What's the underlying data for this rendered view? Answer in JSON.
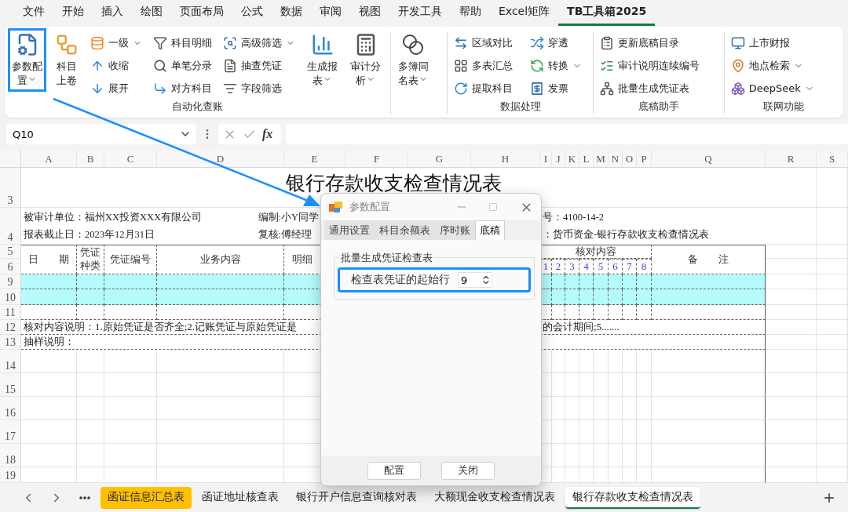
{
  "menu_tabs": [
    {
      "label": "文件",
      "selected": false
    },
    {
      "label": "开始",
      "selected": false
    },
    {
      "label": "插入",
      "selected": false
    },
    {
      "label": "绘图",
      "selected": false
    },
    {
      "label": "页面布局",
      "selected": false
    },
    {
      "label": "公式",
      "selected": false
    },
    {
      "label": "数据",
      "selected": false
    },
    {
      "label": "审阅",
      "selected": false
    },
    {
      "label": "视图",
      "selected": false
    },
    {
      "label": "开发工具",
      "selected": false
    },
    {
      "label": "帮助",
      "selected": false
    },
    {
      "label": "Excel矩阵",
      "selected": false
    },
    {
      "label": "TB工具箱2025",
      "selected": true
    }
  ],
  "ribbon": {
    "groups": [
      {
        "label": "自动化查账",
        "columns": [
          {
            "kind": "large",
            "label": "参数配置",
            "dropdown": true,
            "highlighted": true
          },
          {
            "kind": "large",
            "label": "科目上卷",
            "dropdown": false,
            "highlighted": false
          },
          {
            "kind": "stack",
            "items": [
              {
                "label": "一级",
                "dropdown": true
              },
              {
                "label": "收缩",
                "dropdown": false
              },
              {
                "label": "展开",
                "dropdown": false
              }
            ]
          },
          {
            "kind": "stack",
            "items": [
              {
                "label": "科目明细",
                "dropdown": false
              },
              {
                "label": "单笔分录",
                "dropdown": false
              },
              {
                "label": "对方科目",
                "dropdown": false
              }
            ]
          },
          {
            "kind": "stack",
            "items": [
              {
                "label": "高级筛选",
                "dropdown": true
              },
              {
                "label": "抽查凭证",
                "dropdown": false
              },
              {
                "label": "字段筛选",
                "dropdown": false
              }
            ]
          },
          {
            "kind": "large",
            "label": "生成报表",
            "dropdown": true,
            "highlighted": false
          },
          {
            "kind": "large",
            "label": "审计分析",
            "dropdown": true,
            "highlighted": false
          }
        ]
      },
      {
        "columns": [
          {
            "kind": "large",
            "label": "多簿同名表",
            "dropdown": true,
            "highlighted": false
          }
        ]
      },
      {
        "label": "数据处理",
        "columns": [
          {
            "kind": "stack",
            "items": [
              {
                "label": "区域对比",
                "dropdown": false
              },
              {
                "label": "多表汇总",
                "dropdown": false
              },
              {
                "label": "提取科目",
                "dropdown": false
              }
            ]
          },
          {
            "kind": "stack",
            "items": [
              {
                "label": "穿透",
                "dropdown": false
              },
              {
                "label": "转换",
                "dropdown": true
              },
              {
                "label": "发票",
                "dropdown": false
              }
            ]
          }
        ]
      },
      {
        "label": "底稿助手",
        "columns": [
          {
            "kind": "stack",
            "items": [
              {
                "label": "更新底稿目录",
                "dropdown": false
              },
              {
                "label": "审计说明连续编号",
                "dropdown": false
              },
              {
                "label": "批量生成凭证表",
                "dropdown": false
              }
            ]
          }
        ]
      },
      {
        "label": "联网功能",
        "columns": [
          {
            "kind": "stack",
            "items": [
              {
                "label": "上市财报",
                "dropdown": false
              },
              {
                "label": "地点检索",
                "dropdown": true
              },
              {
                "label": "DeepSeek",
                "dropdown": true
              }
            ]
          }
        ]
      }
    ]
  },
  "formula_bar": {
    "name_box": "Q10",
    "fx": "fx"
  },
  "sheet": {
    "column_headers": [
      "A",
      "B",
      "C",
      "D",
      "E",
      "F",
      "G",
      "H",
      "I",
      "J",
      "K",
      "L",
      "M",
      "N",
      "O",
      "P",
      "Q",
      "R",
      "S"
    ],
    "row_headers": [
      "3",
      "4",
      "5",
      "6",
      "9",
      "10",
      "11",
      "12",
      "13",
      "14",
      "15",
      "16",
      "17",
      "18",
      "19"
    ],
    "title": "银行存款收支检查情况表",
    "info_left": [
      "被审计单位：福州XX投资XXX有限公司",
      "报表截止日：2023年12月31日"
    ],
    "info_middle": [
      "编制:小Y同学",
      "复核:傅经理"
    ],
    "info_right": [
      "号：4100-14-2",
      "：货币资金-银行存款收支检查情况表"
    ],
    "table_headers": [
      "日　　期",
      "凭证种类",
      "凭证编号",
      "业务内容",
      "明细"
    ],
    "check_header": "核对内容",
    "check_numbers": [
      "1",
      "2",
      "3",
      "4",
      "5",
      "6",
      "7",
      "8"
    ],
    "remarks_header": "备　　注",
    "rows": [
      {
        "highlighted": true
      },
      {
        "highlighted": true
      },
      {
        "highlighted": false
      }
    ],
    "note_left": "核对内容说明：1.原始凭证是否齐全;2.记账凭证与原始凭证是",
    "note_right": "的会计期间;5.......",
    "sampling_note": "抽样说明："
  },
  "dialog": {
    "title": "参数配置",
    "tabs": [
      {
        "label": "通用设置",
        "selected": false
      },
      {
        "label": "科目余额表",
        "selected": false
      },
      {
        "label": "序时账",
        "selected": false
      },
      {
        "label": "底稿",
        "selected": true
      }
    ],
    "group_title": "批量生成凭证检查表",
    "field_label": "检查表凭证的起始行",
    "field_value": "9",
    "field_highlighted": true,
    "buttons": [
      "配置",
      "关闭"
    ]
  },
  "sheet_tabs": [
    {
      "label": "函证信息汇总表",
      "selected": false,
      "highlighted": true
    },
    {
      "label": "函证地址核查表",
      "selected": false,
      "highlighted": false
    },
    {
      "label": "银行开户信息查询核对表",
      "selected": false,
      "highlighted": false
    },
    {
      "label": "大额现金收支检查情况表",
      "selected": false,
      "highlighted": false
    },
    {
      "label": "银行存款收支检查情况表",
      "selected": true,
      "highlighted": false
    }
  ]
}
